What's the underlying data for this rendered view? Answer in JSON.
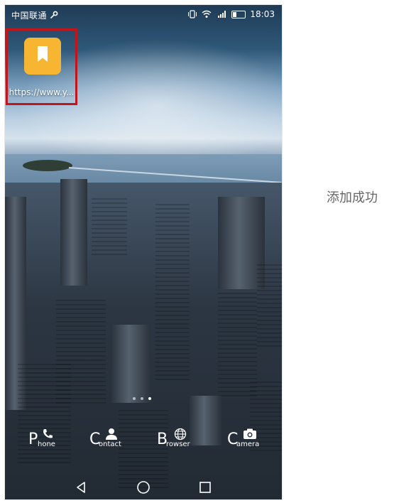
{
  "status_bar": {
    "carrier": "中国联通",
    "time": "18:03"
  },
  "home": {
    "shortcut": {
      "label": "https://www.y...",
      "icon": "bookmark-icon",
      "highlight_color": "#c0161b",
      "icon_color": "#f7b531"
    },
    "page_indicator": {
      "pages": 3,
      "active": 2
    }
  },
  "dock": [
    {
      "big": "P",
      "small": "hone",
      "icon": "phone-icon"
    },
    {
      "big": "C",
      "small": "ontact",
      "icon": "contact-icon"
    },
    {
      "big": "B",
      "small": "rowser",
      "icon": "globe-icon"
    },
    {
      "big": "C",
      "small": "amera",
      "icon": "camera-icon"
    }
  ],
  "nav_bar": [
    "back-icon",
    "home-icon",
    "recents-icon"
  ],
  "toast": {
    "text": "添加成功"
  }
}
